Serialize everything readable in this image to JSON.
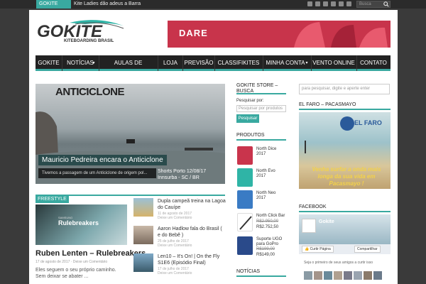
{
  "topbar": {
    "badge": "GOKITE NEWS",
    "ticker": "Kite Ladies dão adeus a Barra",
    "search_placeholder": "Busca",
    "social_icons": [
      "rss-icon",
      "facebook-icon",
      "twitter-icon",
      "youtube-icon",
      "vimeo-icon",
      "email-icon"
    ]
  },
  "logo": {
    "main": "GOKITE",
    "sub": "KITEBOARDING BRASIL"
  },
  "banner": {
    "text": "DARE"
  },
  "nav": {
    "items": [
      "GOKITE",
      "NOTÍCIAS",
      "AULAS DE KITESURF",
      "LOJA",
      "PREVISÃO",
      "CLASSIFIKITES",
      "MINHA CONTA",
      "VENTO ONLINE",
      "CONTATO"
    ]
  },
  "slider": {
    "headline": "ANTICICLONE",
    "caption": "Mauricio Pedreira encara o Anticiclone",
    "excerpt": "Tivemos a passagem de um Anticiclone de origem pol...",
    "next": "Shorts Porto 12/08/17 Innsurba - SC / BR"
  },
  "featured": {
    "tag": "FREESTYLE",
    "img_brand": "SAMSUNG",
    "img_title": "Rulebreakers",
    "title": "Ruben Lenten – Rulebreakers",
    "date": "17 de agosto de 2017",
    "comments": "Deixe um Comentário",
    "excerpt": "Eles seguem o seu próprio caminho. Sem deixar se abater ..."
  },
  "list": [
    {
      "title": "Dupla campeã treina na Lagoa do Cauípe",
      "date": "11 de agosto de 2017",
      "comments": "Deixe um Comentário"
    },
    {
      "title": "Aaron Hadlow fala do Brasil ( e do Bebê )",
      "date": "25 de julho de 2017",
      "comments": "Deixe um Comentário"
    },
    {
      "title": "Len10 – It's On! | On the Fly S1E6 (Episódio Final)",
      "date": "17 de julho de 2017",
      "comments": "Deixe um Comentário"
    }
  ],
  "store": {
    "heading": "GOKITE STORE – BUSCA",
    "label": "Pesquisar por:",
    "placeholder": "Pesquisar por produtos",
    "button": "Pesquisar",
    "products_heading": "PRODUTOS",
    "products": [
      {
        "name": "North Dice 2017",
        "old": "",
        "price": "",
        "color": "#c9344c"
      },
      {
        "name": "North Evo 2017",
        "old": "",
        "price": "",
        "color": "#2fb4a6"
      },
      {
        "name": "North Neo 2017",
        "old": "",
        "price": "",
        "color": "#3a7bc4"
      },
      {
        "name": "North Click Bar",
        "old": "R$2.950,00",
        "price": "R$2.752,50",
        "color": "#333333"
      },
      {
        "name": "Suporte UGO para GoPro",
        "old": "R$199,00",
        "price": "R$149,00",
        "color": "#2a4a8a"
      }
    ],
    "news_heading": "NOTÍCIAS"
  },
  "right": {
    "search_placeholder": "para pesquisar, digite e aperte enter",
    "faro_heading": "EL FARO – PACASMAYO",
    "faro_logo": "EL FARO",
    "faro_text": "Venha surfar a onda mais longa da sua vida em Pacasmayo !",
    "facebook_heading": "FACEBOOK",
    "fb_name": "Gokite",
    "fb_like": "Curtir Página",
    "fb_share": "Compartilhar",
    "fb_friends": "Seja o primeiro de seus amigos a curtir isso"
  }
}
